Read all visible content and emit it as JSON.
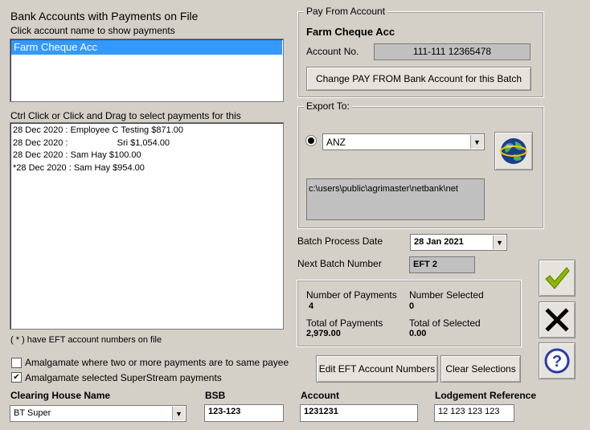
{
  "left": {
    "accounts_heading": "Bank Accounts with Payments on File",
    "accounts_subheading": "Click account name to show payments",
    "accounts": [
      "Farm Cheque Acc"
    ],
    "payments_heading": "Ctrl Click or Click and Drag to select payments for this",
    "payments": [
      "28 Dec 2020 : Employee C Testing $871.00",
      "28 Dec 2020 :                    Sri $1,054.00",
      "28 Dec 2020 : Sam Hay $100.00",
      "*28 Dec 2020 : Sam Hay $954.00"
    ],
    "eft_note": "( * )  have EFT account numbers on file",
    "amalgamate_label": "Amalgamate where two or more payments are to same payee",
    "amalgamate_checked": false,
    "superstream_label": "Amalgamate selected SuperStream payments",
    "superstream_checked": true
  },
  "pay_from": {
    "group_title": "Pay From Account",
    "account_name": "Farm Cheque Acc",
    "account_no_label": "Account No.",
    "account_no": "111-111 12365478",
    "change_button": "Change PAY FROM Bank Account for this Batch"
  },
  "export": {
    "group_title": "Export To:",
    "bank": "ANZ",
    "path": "c:\\users\\public\\agrimaster\\netbank\\net"
  },
  "batch": {
    "date_label": "Batch Process Date",
    "date_value": "28  Jan  2021",
    "number_label": "Next Batch Number",
    "number_value": "EFT 2"
  },
  "summary": {
    "num_payments_label": "Number of Payments",
    "num_payments": "4",
    "num_selected_label": "Number Selected",
    "num_selected": "0",
    "total_payments_label": "Total of Payments",
    "total_payments": "2,979.00",
    "total_selected_label": "Total of Selected",
    "total_selected": "0.00"
  },
  "buttons": {
    "edit_eft": "Edit EFT Account Numbers",
    "clear_selections": "Clear Selections"
  },
  "bottom": {
    "clearing_house_label": "Clearing House Name",
    "clearing_house_value": "BT Super",
    "bsb_label": "BSB",
    "bsb_value": "123-123",
    "account_label": "Account",
    "account_value": "1231231",
    "lodgement_label": "Lodgement Reference",
    "lodgement_value": "12 123 123 123"
  },
  "colors": {
    "background": "#d4d0c8",
    "selection": "#3399ff",
    "ok_green": "#8db600",
    "help_blue": "#2b3aa8"
  },
  "icons": [
    "globe-icon",
    "checkmark-icon",
    "close-x-icon",
    "help-question-icon"
  ]
}
